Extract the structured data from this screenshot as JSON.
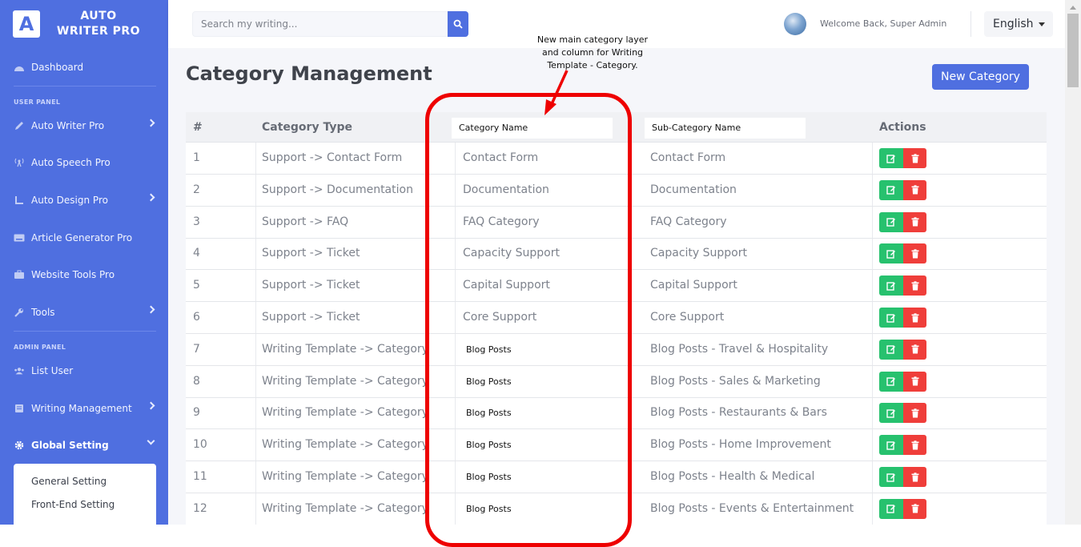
{
  "brand": {
    "logo_letter": "A",
    "name": "AUTO\nWRITER PRO"
  },
  "sidebar": {
    "dashboard": "Dashboard",
    "user_panel_label": "USER PANEL",
    "items_user": [
      {
        "label": "Auto Writer Pro",
        "icon": "pen-icon"
      },
      {
        "label": "Auto Speech Pro",
        "icon": "broadcast-icon"
      },
      {
        "label": "Auto Design Pro",
        "icon": "ruler-icon"
      },
      {
        "label": "Article Generator Pro",
        "icon": "keyboard-icon"
      },
      {
        "label": "Website Tools Pro",
        "icon": "briefcase-icon"
      },
      {
        "label": "Tools",
        "icon": "wrench-icon"
      }
    ],
    "admin_panel_label": "ADMIN PANEL",
    "items_admin": [
      {
        "label": "List User",
        "icon": "users-icon"
      },
      {
        "label": "Writing Management",
        "icon": "notebook-icon"
      },
      {
        "label": "Global Setting",
        "icon": "gear-icon"
      }
    ],
    "submenu": [
      "General Setting",
      "Front-End Setting"
    ]
  },
  "topbar": {
    "search_placeholder": "Search my writing...",
    "welcome": "Welcome Back, Super Admin",
    "language": "English"
  },
  "page": {
    "title": "Category Management",
    "new_button": "New Category"
  },
  "table": {
    "headers": [
      "#",
      "Category Type",
      "Category Name",
      "Sub-Category Name",
      "Actions"
    ],
    "rows": [
      {
        "num": "1",
        "type": "Support -> Contact Form",
        "name": "Contact Form",
        "sub": "Contact Form"
      },
      {
        "num": "2",
        "type": "Support -> Documentation",
        "name": "Documentation",
        "sub": "Documentation"
      },
      {
        "num": "3",
        "type": "Support -> FAQ",
        "name": "FAQ Category",
        "sub": "FAQ Category"
      },
      {
        "num": "4",
        "type": "Support -> Ticket",
        "name": "Capacity Support",
        "sub": "Capacity Support"
      },
      {
        "num": "5",
        "type": "Support -> Ticket",
        "name": "Capital Support",
        "sub": "Capital Support"
      },
      {
        "num": "6",
        "type": "Support -> Ticket",
        "name": "Core Support",
        "sub": "Core Support"
      },
      {
        "num": "7",
        "type": "Writing Template -> Category",
        "name": "Blog Posts",
        "sub": "Blog Posts - Travel & Hospitality"
      },
      {
        "num": "8",
        "type": "Writing Template -> Category",
        "name": "Blog Posts",
        "sub": "Blog Posts - Sales & Marketing"
      },
      {
        "num": "9",
        "type": "Writing Template -> Category",
        "name": "Blog Posts",
        "sub": "Blog Posts - Restaurants & Bars"
      },
      {
        "num": "10",
        "type": "Writing Template -> Category",
        "name": "Blog Posts",
        "sub": "Blog Posts - Home Improvement"
      },
      {
        "num": "11",
        "type": "Writing Template -> Category",
        "name": "Blog Posts",
        "sub": "Blog Posts - Health & Medical"
      },
      {
        "num": "12",
        "type": "Writing Template -> Category",
        "name": "Blog Posts",
        "sub": "Blog Posts - Events & Entertainment"
      }
    ]
  },
  "annotation": {
    "text": "New  main category layer and column for Writing Template - Category.",
    "color": "#ee0000"
  },
  "colors": {
    "accent": "#4f6fe0",
    "edit": "#27c16e",
    "delete": "#ef3e3a"
  }
}
